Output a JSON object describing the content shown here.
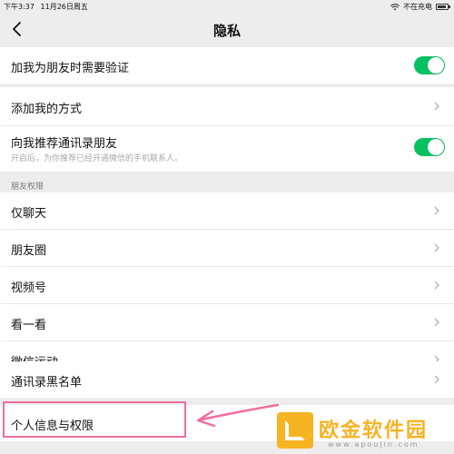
{
  "status_bar": {
    "time": "下午3:37",
    "date": "11月26日周五",
    "charging": "不在充电"
  },
  "nav": {
    "title": "隐私"
  },
  "rows": {
    "verify": {
      "label": "加我为朋友时需要验证",
      "toggle_on": true
    },
    "add_method": {
      "label": "添加我的方式"
    },
    "recommend": {
      "label": "向我推荐通讯录朋友",
      "sub": "开启后，为你推荐已经开通微信的手机联系人。",
      "toggle_on": true
    }
  },
  "friend_permissions": {
    "header": "朋友权限",
    "items": [
      {
        "label": "仅聊天"
      },
      {
        "label": "朋友圈"
      },
      {
        "label": "视频号"
      },
      {
        "label": "看一看"
      },
      {
        "label": "微信运动"
      }
    ]
  },
  "blacklist": {
    "label": "通讯录黑名单"
  },
  "personal_info": {
    "label": "个人信息与权限"
  },
  "watermark": {
    "name": "欧金软件园",
    "url": "www.apoujin.com"
  },
  "colors": {
    "toggle_on": "#07c160",
    "highlight": "#f06ea0",
    "watermark": "#f6b322"
  }
}
